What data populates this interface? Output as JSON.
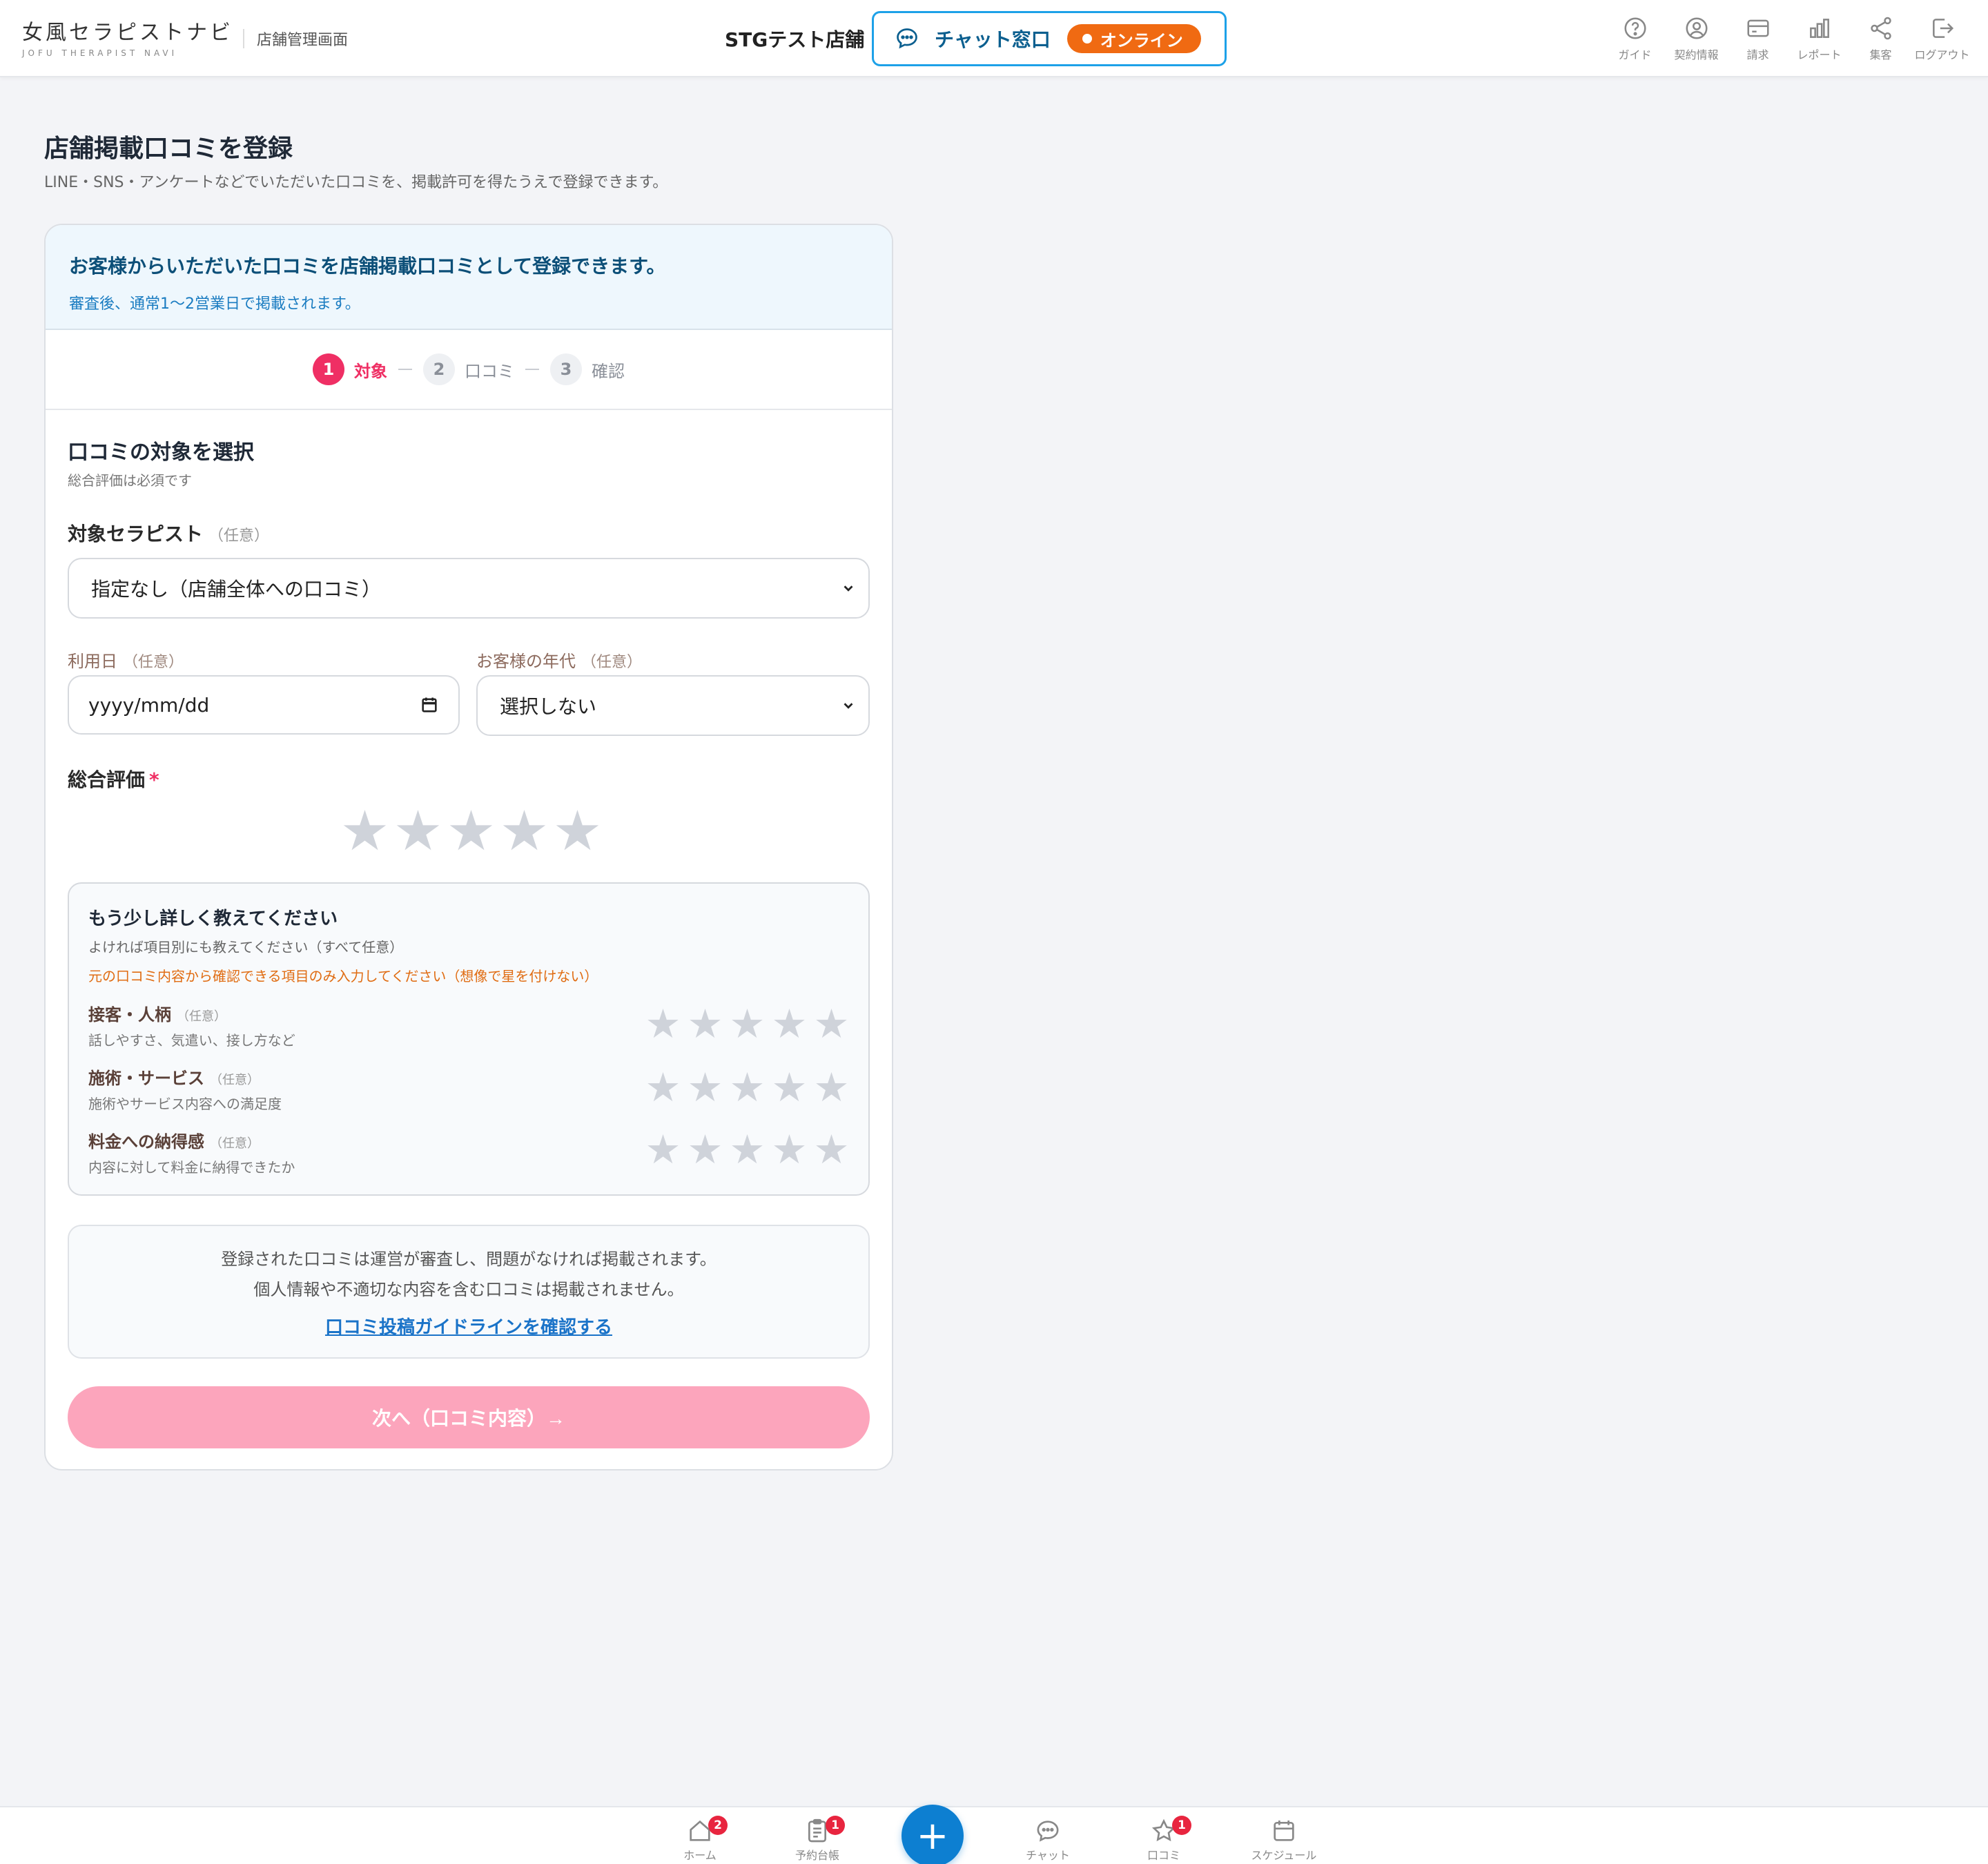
{
  "header": {
    "logo_main": "女風セラピストナビ",
    "logo_sub": "JOFU THERAPIST NAVI",
    "admin_label": "店舗管理画面",
    "store_name": "STGテスト店舗",
    "chat_label": "チャット窓口",
    "chat_status": "オンライン",
    "nav": [
      {
        "label": "ガイド",
        "icon": "help-circle-icon"
      },
      {
        "label": "契約情報",
        "icon": "user-circle-icon"
      },
      {
        "label": "請求",
        "icon": "credit-card-icon"
      },
      {
        "label": "レポート",
        "icon": "bar-chart-icon"
      },
      {
        "label": "集客",
        "icon": "share-icon"
      },
      {
        "label": "ログアウト",
        "icon": "logout-icon"
      }
    ]
  },
  "page": {
    "title": "店舗掲載口コミを登録",
    "subtitle": "LINE・SNS・アンケートなどでいただいた口コミを、掲載許可を得たうえで登録できます。"
  },
  "banner": {
    "title": "お客様からいただいた口コミを店舗掲載口コミとして登録できます。",
    "sub": "審査後、通常1〜2営業日で掲載されます。"
  },
  "steps": [
    {
      "num": "1",
      "label": "対象",
      "active": true
    },
    {
      "num": "2",
      "label": "口コミ",
      "active": false
    },
    {
      "num": "3",
      "label": "確認",
      "active": false
    }
  ],
  "form": {
    "section_title": "口コミの対象を選択",
    "section_sub": "総合評価は必須です",
    "therapist_label": "対象セラピスト",
    "optional": "（任意）",
    "therapist_value": "指定なし（店舗全体への口コミ）",
    "date_label": "利用日",
    "date_placeholder": "yyyy/mm/dd",
    "age_label": "お客様の年代",
    "age_value": "選択しない",
    "overall_label": "総合評価",
    "required_mark": "*",
    "overall_rating": 0,
    "star_max": 5
  },
  "detail": {
    "title": "もう少し詳しく教えてください",
    "sub": "よければ項目別にも教えてください（すべて任意）",
    "warning": "元の口コミ内容から確認できる項目のみ入力してください（想像で星を付けない）",
    "criteria": [
      {
        "label": "接客・人柄",
        "optional": "（任意）",
        "desc": "話しやすさ、気遣い、接し方など",
        "rating": 0
      },
      {
        "label": "施術・サービス",
        "optional": "（任意）",
        "desc": "施術やサービス内容への満足度",
        "rating": 0
      },
      {
        "label": "料金への納得感",
        "optional": "（任意）",
        "desc": "内容に対して料金に納得できたか",
        "rating": 0
      }
    ]
  },
  "notice": {
    "line1": "登録された口コミは運営が審査し、問題がなければ掲載されます。",
    "line2": "個人情報や不適切な内容を含む口コミは掲載されません。",
    "link": "口コミ投稿ガイドラインを確認する"
  },
  "next_button": "次へ（口コミ内容）→",
  "bottom_nav": [
    {
      "label": "ホーム",
      "icon": "home-icon",
      "badge": "2"
    },
    {
      "label": "予約台帳",
      "icon": "clipboard-icon",
      "badge": "1"
    },
    {
      "label": "チャット",
      "icon": "chat-bubble-icon",
      "badge": ""
    },
    {
      "label": "口コミ",
      "icon": "star-icon",
      "badge": "1"
    },
    {
      "label": "スケジュール",
      "icon": "calendar-icon",
      "badge": ""
    }
  ],
  "fab_label": "+",
  "star_glyph": "★",
  "colors": {
    "accent_pink": "#ef2f64",
    "chat_blue": "#1da1e8",
    "online_orange": "#f06a12",
    "fab_blue": "#0d7fd1",
    "star_empty": "#cfd3da"
  }
}
